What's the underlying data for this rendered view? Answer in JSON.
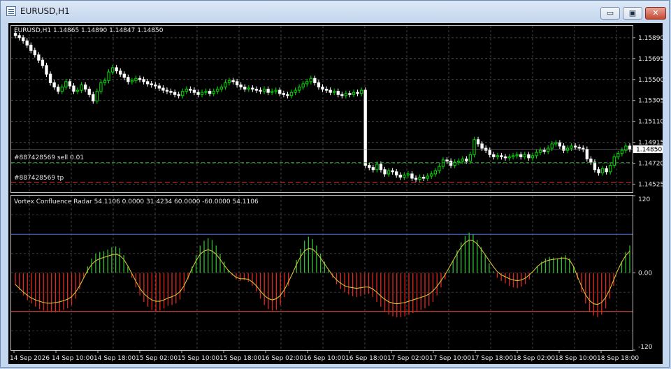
{
  "window": {
    "title": "EURUSD,H1"
  },
  "window_buttons": {
    "minimize": "▭",
    "restore": "▣",
    "close": "✕"
  },
  "price_pane": {
    "header": "EURUSD,H1  1.14865 1.14890 1.14847 1.14850",
    "order_label": "#887428569 sell 0.01",
    "tp_label": "#887428569 tp",
    "current_price": "1.14850"
  },
  "indicator_pane": {
    "header": "Vortex Confluence Radar 54.1106 0.0000 31.4234 60.0000 -60.0000 54.1106"
  },
  "colors": {
    "bull": "#00dc00",
    "bear": "#ffffff",
    "hist_up": "#2fbf2f",
    "hist_down": "#e0281e",
    "signal": "#d8c13a",
    "level_up": "#4f6fe0",
    "level_down": "#e24a3a",
    "grid": "#6e6e6e"
  },
  "chart_data": [
    {
      "type": "candlestick",
      "y_tick_labels": [
        "1.15890",
        "1.15695",
        "1.15500",
        "1.15305",
        "1.15110",
        "1.14915",
        "1.14720",
        "1.14525"
      ],
      "ylim": [
        1.1445,
        1.16
      ],
      "order_price": 1.14725,
      "tp_price": 1.1454,
      "x_tick_labels": [
        "14 Sep 2026",
        "14 Sep 10:00",
        "14 Sep 18:00",
        "15 Sep 02:00",
        "15 Sep 10:00",
        "15 Sep 18:00",
        "16 Sep 02:00",
        "16 Sep 10:00",
        "16 Sep 18:00",
        "17 Sep 02:00",
        "17 Sep 10:00",
        "17 Sep 18:00",
        "18 Sep 02:00",
        "18 Sep 10:00",
        "18 Sep 18:00"
      ],
      "close": [
        1.1591,
        1.1589,
        1.1586,
        1.1582,
        1.1577,
        1.1573,
        1.1568,
        1.1563,
        1.1555,
        1.1547,
        1.1543,
        1.1539,
        1.1543,
        1.1548,
        1.1544,
        1.1539,
        1.154,
        1.1545,
        1.1541,
        1.1536,
        1.153,
        1.1539,
        1.1547,
        1.1549,
        1.1557,
        1.1561,
        1.1558,
        1.1555,
        1.1552,
        1.1548,
        1.1549,
        1.1551,
        1.155,
        1.1548,
        1.1546,
        1.1545,
        1.1544,
        1.1542,
        1.154,
        1.1539,
        1.1538,
        1.1536,
        1.1535,
        1.1539,
        1.1541,
        1.154,
        1.1538,
        1.1536,
        1.1538,
        1.1539,
        1.1537,
        1.1539,
        1.1541,
        1.1543,
        1.1547,
        1.1549,
        1.1548,
        1.1545,
        1.1543,
        1.1541,
        1.1542,
        1.1541,
        1.154,
        1.1539,
        1.1541,
        1.1538,
        1.1539,
        1.154,
        1.1537,
        1.1536,
        1.1535,
        1.1538,
        1.154,
        1.1543,
        1.1546,
        1.1548,
        1.1551,
        1.1547,
        1.1543,
        1.1541,
        1.154,
        1.1538,
        1.1539,
        1.1536,
        1.1535,
        1.1537,
        1.1536,
        1.1538,
        1.1537,
        1.154,
        1.147,
        1.1468,
        1.1466,
        1.1471,
        1.1466,
        1.1462,
        1.1465,
        1.1464,
        1.1461,
        1.1459,
        1.1461,
        1.1462,
        1.1458,
        1.1457,
        1.1459,
        1.1458,
        1.146,
        1.1462,
        1.1465,
        1.1469,
        1.1475,
        1.1474,
        1.147,
        1.1473,
        1.1474,
        1.1476,
        1.1474,
        1.148,
        1.1494,
        1.149,
        1.1486,
        1.1484,
        1.148,
        1.1478,
        1.1479,
        1.1478,
        1.1477,
        1.1478,
        1.1479,
        1.148,
        1.1478,
        1.148,
        1.1477,
        1.1479,
        1.1482,
        1.1484,
        1.1483,
        1.1486,
        1.149,
        1.1491,
        1.1488,
        1.1484,
        1.1486,
        1.1488,
        1.1487,
        1.1486,
        1.1485,
        1.1476,
        1.1473,
        1.1466,
        1.1463,
        1.1467,
        1.1464,
        1.147,
        1.1478,
        1.1481,
        1.1484,
        1.1488,
        1.1485
      ]
    },
    {
      "type": "bar+line",
      "y_tick_labels": [
        "120",
        "0.00",
        "-120"
      ],
      "ylim": [
        -120,
        120
      ],
      "levels": [
        60,
        -60
      ],
      "histogram_scale": [
        -15,
        -21,
        -28,
        -34,
        -38,
        -42,
        -45,
        -47,
        -48,
        -49,
        -49,
        -48,
        -46,
        -44,
        -40,
        -32,
        -20,
        -6,
        8,
        18,
        24,
        26,
        27,
        29,
        32,
        33,
        31,
        22,
        8,
        -6,
        -18,
        -28,
        -36,
        -42,
        -46,
        -48,
        -47,
        -44,
        -41,
        -40,
        -38,
        -33,
        -23,
        -8,
        8,
        22,
        34,
        40,
        43,
        41,
        34,
        24,
        14,
        4,
        -3,
        -8,
        -10,
        -9,
        -11,
        -16,
        -23,
        -32,
        -40,
        -45,
        -47,
        -46,
        -40,
        -30,
        -16,
        0,
        16,
        30,
        40,
        45,
        42,
        34,
        24,
        14,
        4,
        -6,
        -14,
        -20,
        -24,
        -27,
        -29,
        -30,
        -29,
        -27,
        -26,
        -30,
        -36,
        -42,
        -48,
        -52,
        -54,
        -55,
        -55,
        -54,
        -52,
        -50,
        -48,
        -46,
        -44,
        -41,
        -36,
        -28,
        -18,
        -8,
        4,
        16,
        28,
        38,
        46,
        50,
        48,
        41,
        32,
        22,
        12,
        2,
        -6,
        -10,
        -13,
        -16,
        -18,
        -19,
        -17,
        -14,
        -8,
        0,
        8,
        14,
        18,
        20,
        19,
        18,
        20,
        22,
        18,
        8,
        -8,
        -24,
        -38,
        -48,
        -53,
        -55,
        -52,
        -44,
        -32,
        -16,
        0,
        14,
        26,
        34
      ],
      "signal": [
        -18,
        -24,
        -30,
        -35,
        -39,
        -42,
        -44,
        -46,
        -47,
        -47,
        -46,
        -45,
        -43,
        -41,
        -37,
        -30,
        -20,
        -8,
        4,
        13,
        19,
        22,
        24,
        26,
        28,
        29,
        27,
        21,
        11,
        -1,
        -13,
        -24,
        -32,
        -38,
        -42,
        -44,
        -44,
        -42,
        -39,
        -37,
        -34,
        -29,
        -20,
        -7,
        7,
        19,
        29,
        34,
        36,
        34,
        29,
        21,
        12,
        4,
        -2,
        -7,
        -9,
        -9,
        -10,
        -14,
        -20,
        -28,
        -35,
        -40,
        -42,
        -40,
        -35,
        -26,
        -14,
        -1,
        13,
        25,
        34,
        38,
        37,
        31,
        23,
        14,
        5,
        -4,
        -11,
        -16,
        -20,
        -22,
        -23,
        -24,
        -23,
        -22,
        -22,
        -25,
        -30,
        -36,
        -41,
        -45,
        -47,
        -48,
        -47,
        -46,
        -44,
        -42,
        -40,
        -38,
        -36,
        -33,
        -28,
        -21,
        -12,
        -3,
        8,
        19,
        30,
        40,
        47,
        51,
        50,
        45,
        37,
        28,
        19,
        10,
        2,
        -3,
        -6,
        -9,
        -11,
        -12,
        -11,
        -8,
        -3,
        3,
        10,
        15,
        18,
        20,
        21,
        22,
        23,
        23,
        20,
        10,
        -6,
        -21,
        -34,
        -43,
        -48,
        -49,
        -46,
        -38,
        -26,
        -11,
        4,
        17,
        27,
        34
      ]
    }
  ]
}
